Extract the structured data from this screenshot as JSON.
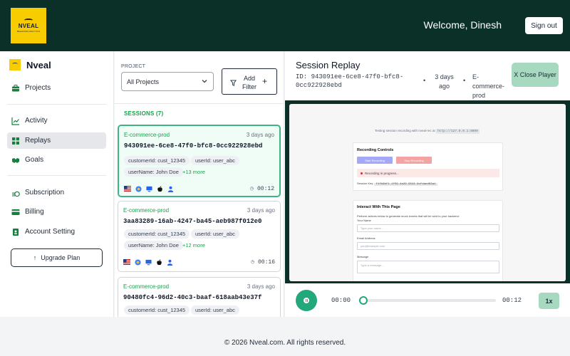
{
  "header": {
    "logo_text": "NVEAL",
    "logo_tagline": "BEHAVIOR ANALYTICS",
    "welcome": "Welcome, Dinesh",
    "signout_label": "Sign out"
  },
  "sidebar": {
    "brand": "Nveal",
    "items": [
      {
        "label": "Projects",
        "icon": "briefcase-icon"
      },
      {
        "label": "Activity",
        "icon": "chart-line-icon"
      },
      {
        "label": "Replays",
        "icon": "grid-icon",
        "active": true
      },
      {
        "label": "Goals",
        "icon": "handshake-icon"
      },
      {
        "label": "Subscription",
        "icon": "coins-icon"
      },
      {
        "label": "Billing",
        "icon": "credit-card-icon"
      },
      {
        "label": "Account Setting",
        "icon": "id-badge-icon"
      }
    ],
    "upgrade_label": "Upgrade Plan"
  },
  "sessions": {
    "project_label": "PROJECT",
    "project_value": "All Projects",
    "add_filter_label": "Add Filter",
    "heading": "SESSIONS (7)",
    "cards": [
      {
        "project": "E-commerce-prod",
        "ago": "3 days ago",
        "id": "943091ee-6ce8-47f0-bfc8-0cc922928ebd",
        "customer": "customerId: cust_12345",
        "user": "userId: user_abc",
        "username": "userName: John Doe",
        "more": "+13 more",
        "duration": "00:12"
      },
      {
        "project": "E-commerce-prod",
        "ago": "3 days ago",
        "id": "3aa83289-16ab-4247-ba45-aeb987f012e0",
        "customer": "customerId: cust_12345",
        "user": "userId: user_abc",
        "username": "userName: John Doe",
        "more": "+12 more",
        "duration": "00:16"
      },
      {
        "project": "E-commerce-prod",
        "ago": "3 days ago",
        "id": "90480fc4-96d2-40c3-baaf-618aab43e37f",
        "customer": "customerId: cust_12345",
        "user": "userId: user_abc"
      }
    ]
  },
  "replay": {
    "title": "Session Replay",
    "id_text": "ID: 943091ee-6ce8-47f0-bfc8-0cc922928ebd",
    "ago": "3 days ago",
    "project": "E-commerce-prod",
    "close_label": "X Close Player",
    "screen": {
      "intro": "Testing session recording with nveal-rec at",
      "url": "http://127.0.0.1:8000",
      "recording_heading": "Recording Controls",
      "start_label": "Start Recording",
      "stop_label": "Stop Recording",
      "recording_status": "Recording in progress...",
      "session_key_label": "Session Key:",
      "session_key": "f1fb9bf1-1f59-4a29-9544-9cfdaed03a1",
      "interact_heading": "Interact With This Page",
      "interact_text": "Perform actions below to generate mock events that will be sent to your backend:",
      "name_label": "Your Name",
      "name_placeholder": "Type your name...",
      "email_label": "Email Address",
      "email_placeholder": "you@example.com",
      "message_label": "Message",
      "message_placeholder": "Type a message..."
    },
    "player": {
      "current_time": "00:00",
      "end_time": "00:12",
      "progress": 0,
      "speed": "1x"
    }
  },
  "footer": {
    "text": "© 2026 Nveal.com. All rights reserved."
  },
  "colors": {
    "header_bg": "#0b3027",
    "accent_green": "#22a87a",
    "light_green": "#a7d9c1",
    "logo_yellow": "#f7cc00"
  }
}
